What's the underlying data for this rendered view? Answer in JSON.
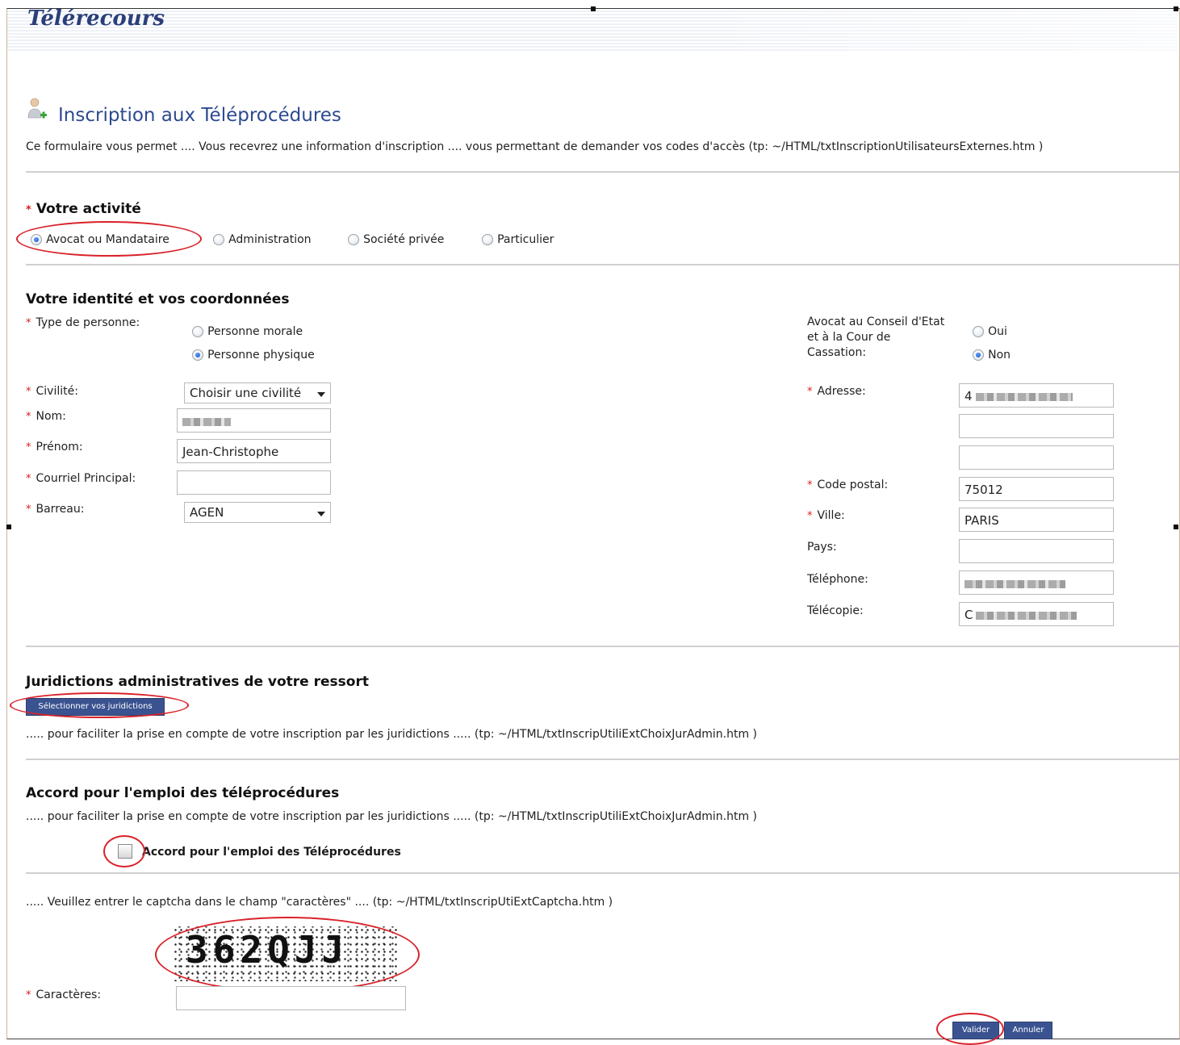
{
  "brand": "Télérecours",
  "page_title": "Inscription aux Téléprocédures",
  "intro": "Ce formulaire vous permet .... Vous recevrez une information d'inscription .... vous permettant de demander vos codes d'accès (tp: ~/HTML/txtInscriptionUtilisateursExternes.htm )",
  "required_mark": "*",
  "activite": {
    "title": "Votre activité",
    "options": [
      "Avocat ou Mandataire",
      "Administration",
      "Société privée",
      "Particulier"
    ],
    "selected": "Avocat ou Mandataire"
  },
  "identite": {
    "title": "Votre identité et vos coordonnées",
    "type_personne_label": "Type de personne:",
    "type_personne_options": [
      "Personne morale",
      "Personne physique"
    ],
    "type_personne_selected": "Personne physique",
    "civilite_label": "Civilité:",
    "civilite_value": "Choisir une civilité",
    "nom_label": "Nom:",
    "prenom_label": "Prénom:",
    "prenom_value": "Jean-Christophe",
    "courriel_label": "Courriel Principal:",
    "courriel_value": "",
    "barreau_label": "Barreau:",
    "barreau_value": "AGEN",
    "avocat_conseil_label_1": "Avocat au Conseil d'Etat",
    "avocat_conseil_label_2": "et à la Cour de",
    "avocat_conseil_label_3": "Cassation:",
    "avocat_conseil_options": [
      "Oui",
      "Non"
    ],
    "avocat_conseil_selected": "Non",
    "adresse_label": "Adresse:",
    "adresse_prefix": "4",
    "code_postal_label": "Code postal:",
    "code_postal_value": "75012",
    "ville_label": "Ville:",
    "ville_value": "PARIS",
    "pays_label": "Pays:",
    "telephone_label": "Téléphone:",
    "telecopie_label": "Télécopie:",
    "telecopie_prefix": "C"
  },
  "juridictions": {
    "title": "Juridictions administratives de votre ressort",
    "button_label": "Sélectionner vos juridictions",
    "desc": "..... pour faciliter la prise en compte de votre inscription par les juridictions ..... (tp: ~/HTML/txtInscripUtiliExtChoixJurAdmin.htm )"
  },
  "accord": {
    "title": "Accord pour l'emploi des téléprocédures",
    "desc": "..... pour faciliter la prise en compte de votre inscription par les juridictions ..... (tp: ~/HTML/txtInscripUtiliExtChoixJurAdmin.htm )",
    "checkbox_label": "Accord pour l'emploi des Téléprocédures",
    "checked": false
  },
  "captcha": {
    "desc": "..... Veuillez entrer le captcha dans le champ \"caractères\" .... (tp: ~/HTML/txtInscripUtiExtCaptcha.htm )",
    "image_text": "362QJJ",
    "field_label": "Caractères:",
    "value": ""
  },
  "buttons": {
    "valider": "Valider",
    "annuler": "Annuler"
  },
  "colors": {
    "brand": "#2a3f7a",
    "title": "#2d4a8f",
    "required": "#d81e1e",
    "button": "#3a5390",
    "annotation": "#d9222a"
  }
}
